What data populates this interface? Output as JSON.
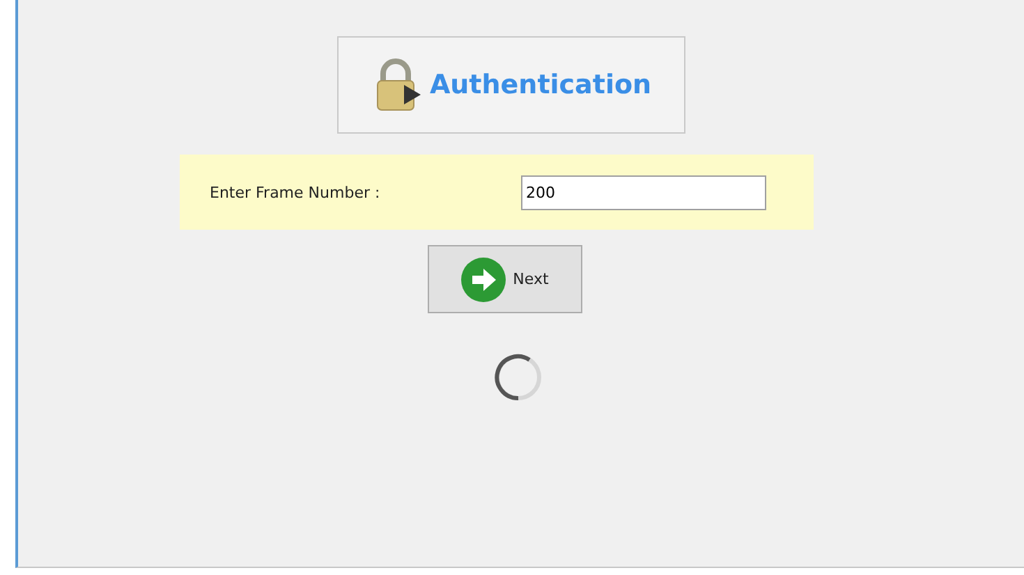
{
  "header": {
    "title": "Authentication"
  },
  "frame_number": {
    "label": "Enter Frame Number :",
    "value": "200"
  },
  "next_button": {
    "label": "Next"
  }
}
